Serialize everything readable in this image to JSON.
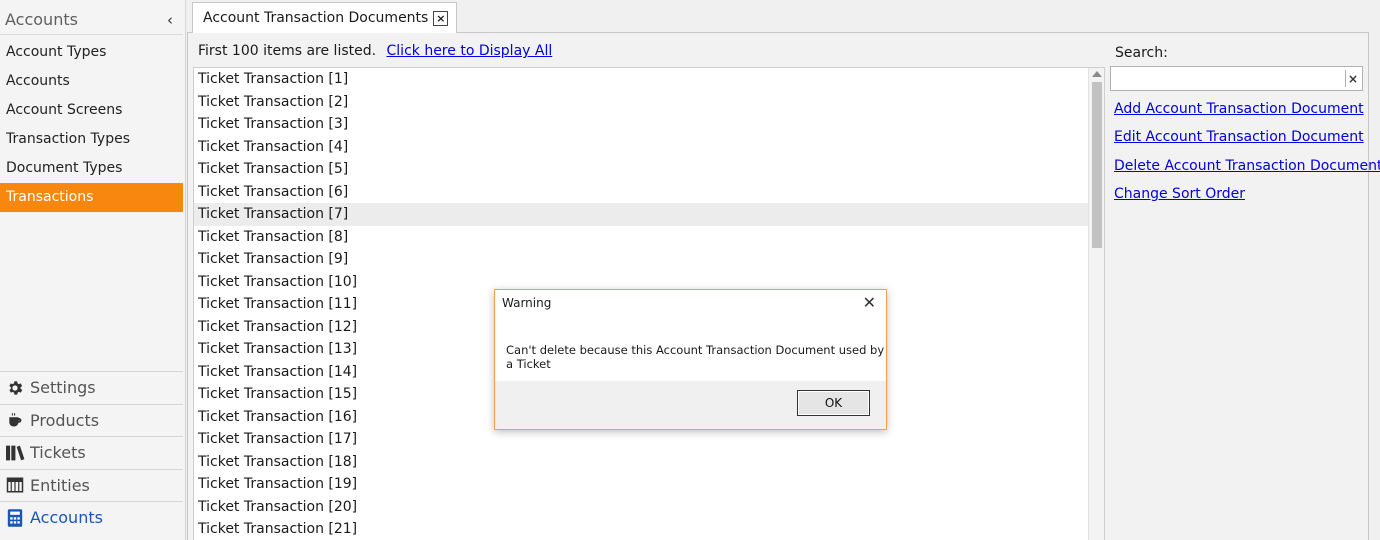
{
  "sidebar": {
    "header_title": "Accounts",
    "items": [
      {
        "label": "Account Types"
      },
      {
        "label": "Accounts"
      },
      {
        "label": "Account Screens"
      },
      {
        "label": "Transaction Types"
      },
      {
        "label": "Document Types"
      },
      {
        "label": "Transactions",
        "active": true
      }
    ],
    "modules": [
      {
        "label": "Settings",
        "icon": "gear-icon"
      },
      {
        "label": "Products",
        "icon": "coffee-cup-icon"
      },
      {
        "label": "Tickets",
        "icon": "books-icon"
      },
      {
        "label": "Entities",
        "icon": "table-grid-icon"
      },
      {
        "label": "Accounts",
        "icon": "calculator-icon",
        "active": true
      }
    ]
  },
  "tab": {
    "title": "Account Transaction Documents",
    "close_label": "×"
  },
  "list": {
    "caption": "First 100 items are listed.",
    "display_all_link": "Click here to Display All",
    "selected_index": 6,
    "rows": [
      "Ticket Transaction [1]",
      "Ticket Transaction [2]",
      "Ticket Transaction [3]",
      "Ticket Transaction [4]",
      "Ticket Transaction [5]",
      "Ticket Transaction [6]",
      "Ticket Transaction [7]",
      "Ticket Transaction [8]",
      "Ticket Transaction [9]",
      "Ticket Transaction [10]",
      "Ticket Transaction [11]",
      "Ticket Transaction [12]",
      "Ticket Transaction [13]",
      "Ticket Transaction [14]",
      "Ticket Transaction [15]",
      "Ticket Transaction [16]",
      "Ticket Transaction [17]",
      "Ticket Transaction [18]",
      "Ticket Transaction [19]",
      "Ticket Transaction [20]",
      "Ticket Transaction [21]"
    ]
  },
  "search": {
    "label": "Search:",
    "value": "",
    "clear_label": "×"
  },
  "actions": [
    "Add Account Transaction Document",
    "Edit Account Transaction Document",
    "Delete Account Transaction Document",
    "Change Sort Order"
  ],
  "dialog": {
    "title": "Warning",
    "message": "Can't delete because this Account Transaction Document used by a Ticket",
    "ok_label": "OK"
  },
  "colors": {
    "accent": "#f7870f",
    "link": "#0000e0",
    "active_module": "#1a56b5",
    "dialog_border": "#f0a14a"
  }
}
